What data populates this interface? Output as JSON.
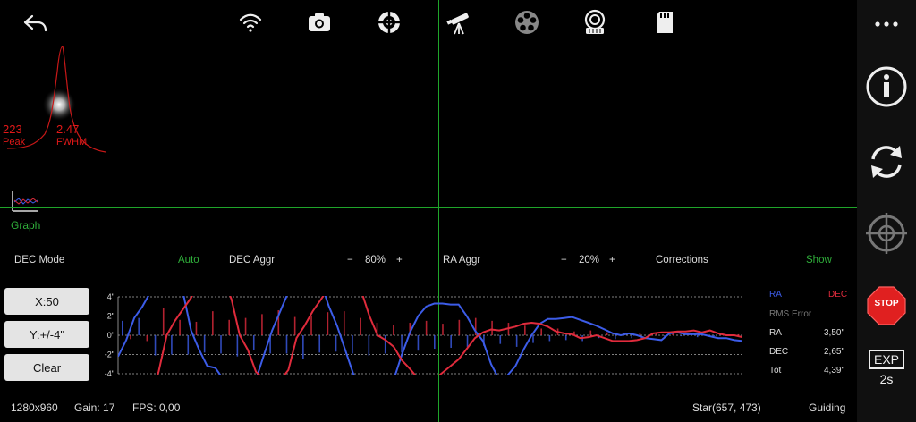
{
  "profile": {
    "peak_value": "223",
    "peak_label": "Peak",
    "fwhm_value": "2.47",
    "fwhm_label": "FWHM"
  },
  "graph_label": "Graph",
  "settings": {
    "dec_mode_label": "DEC Mode",
    "dec_mode_value": "Auto",
    "dec_aggr_label": "DEC Aggr",
    "dec_aggr_minus": "−",
    "dec_aggr_value": "80%",
    "dec_aggr_plus": "+",
    "ra_aggr_label": "RA Aggr",
    "ra_aggr_minus": "−",
    "ra_aggr_value": "20%",
    "ra_aggr_plus": "+",
    "corrections_label": "Corrections",
    "corrections_value": "Show"
  },
  "left_buttons": {
    "x_scale": "X:50",
    "y_scale": "Y:+/-4\"",
    "clear": "Clear"
  },
  "stats": {
    "ra_header": "RA",
    "dec_header": "DEC",
    "rms_label": "RMS Error",
    "rows": [
      {
        "label": "RA",
        "value": "3,50\""
      },
      {
        "label": "DEC",
        "value": "2,65\""
      },
      {
        "label": "Tot",
        "value": "4,39\""
      }
    ]
  },
  "sidebar": {
    "stop_label": "STOP",
    "exp_label": "EXP",
    "exp_value": "2s"
  },
  "status": {
    "resolution": "1280x960",
    "gain": "Gain: 17",
    "fps": "FPS: 0,00",
    "star": "Star(657, 473)",
    "state": "Guiding"
  },
  "colors": {
    "ra": "#3c5ce8",
    "dec": "#e02b3c",
    "crosshair": "#1fa52a",
    "accent": "#2fae3a",
    "stop": "#e02020"
  },
  "chart_data": {
    "type": "line",
    "y_ticks": [
      "4\"",
      "2\"",
      "0\"",
      "-2\"",
      "-4\""
    ],
    "ylim": [
      -4,
      4
    ],
    "series": [
      {
        "name": "RA",
        "values": [
          -2.2,
          -0.5,
          1.8,
          3.0,
          4.5,
          6.0,
          6.0,
          6.0,
          4.5,
          0.5,
          -1.5,
          -3.2,
          -3.4,
          -4.6,
          -6.0,
          -6.0,
          -6.0,
          -4.6,
          -2.0,
          0.5,
          2.5,
          4.5,
          6.0,
          6.0,
          6.0,
          5.5,
          3.0,
          1.0,
          -1.5,
          -4.0,
          -5.5,
          -6.0,
          -6.0,
          -6.0,
          -4.6,
          -2.0,
          0.3,
          2.0,
          3.0,
          3.3,
          3.3,
          3.2,
          3.2,
          2.0,
          0.5,
          -0.6,
          -3.0,
          -4.6,
          -4.2,
          -3.2,
          -1.5,
          0.0,
          1.2,
          1.7,
          1.7,
          1.8,
          1.9,
          1.6,
          1.3,
          1.0,
          0.6,
          0.2,
          0.0,
          0.2,
          0.0,
          -0.3,
          -0.4,
          -0.5,
          0.2,
          0.3,
          0.1,
          0.1,
          0.1,
          -0.1,
          -0.3,
          -0.3,
          -0.5,
          -0.6
        ]
      },
      {
        "name": "DEC",
        "values": [
          -4.5,
          -4.8,
          -4.6,
          -4.5,
          -6.0,
          -3.8,
          0.0,
          1.5,
          2.7,
          3.9,
          5.5,
          6.0,
          6.0,
          6.0,
          3.7,
          0.0,
          -1.5,
          -3.8,
          -4.6,
          -5.5,
          -4.7,
          -3.6,
          -0.3,
          1.0,
          2.5,
          3.7,
          5.0,
          6.0,
          6.0,
          5.9,
          4.6,
          2.0,
          0.0,
          -0.5,
          -1.2,
          -2.6,
          -3.5,
          -4.5,
          -4.7,
          -4.6,
          -3.9,
          -3.2,
          -2.5,
          -1.4,
          -0.3,
          0.3,
          0.6,
          0.5,
          0.7,
          0.9,
          1.2,
          1.3,
          1.2,
          0.9,
          0.4,
          0.2,
          0.1,
          -0.3,
          -0.2,
          0.0,
          -0.3,
          -0.6,
          -0.6,
          -0.6,
          -0.5,
          -0.3,
          0.2,
          0.3,
          0.3,
          0.4,
          0.4,
          0.5,
          0.3,
          0.5,
          0.2,
          0.0,
          0.0,
          -0.2
        ]
      }
    ],
    "corrections": [
      1.5,
      -0.4,
      1.8,
      -0.6,
      -2.1,
      2.8,
      -2.0,
      1.6,
      -2.0,
      1.4,
      -1.8,
      2.5,
      -1.9,
      1.6,
      -2.2,
      1.8,
      -1.5,
      2.2,
      -1.9,
      2.6,
      -1.9,
      1.9,
      -2.5,
      2.0,
      -1.8,
      2.4,
      -1.7,
      2.5,
      -1.9,
      1.8,
      -2.1,
      1.3,
      -1.9,
      1.1,
      -1.8,
      1.3,
      -1.6,
      1.5,
      -1.4,
      1.2,
      -1.3,
      1.6,
      -1.2,
      1.8,
      -1.1,
      1.5,
      -0.9,
      1.3,
      -1.2,
      1.0,
      -0.8,
      0.7,
      -0.6,
      0.7,
      -0.5,
      0.4,
      -0.6,
      0.5,
      -0.3,
      0.3,
      -0.4,
      0.2,
      -0.3,
      0.2,
      -0.2,
      0.2,
      -0.2,
      0.2,
      -0.1,
      0.2,
      -0.2,
      0.1,
      -0.1,
      0.1,
      -0.1,
      0.1
    ]
  }
}
